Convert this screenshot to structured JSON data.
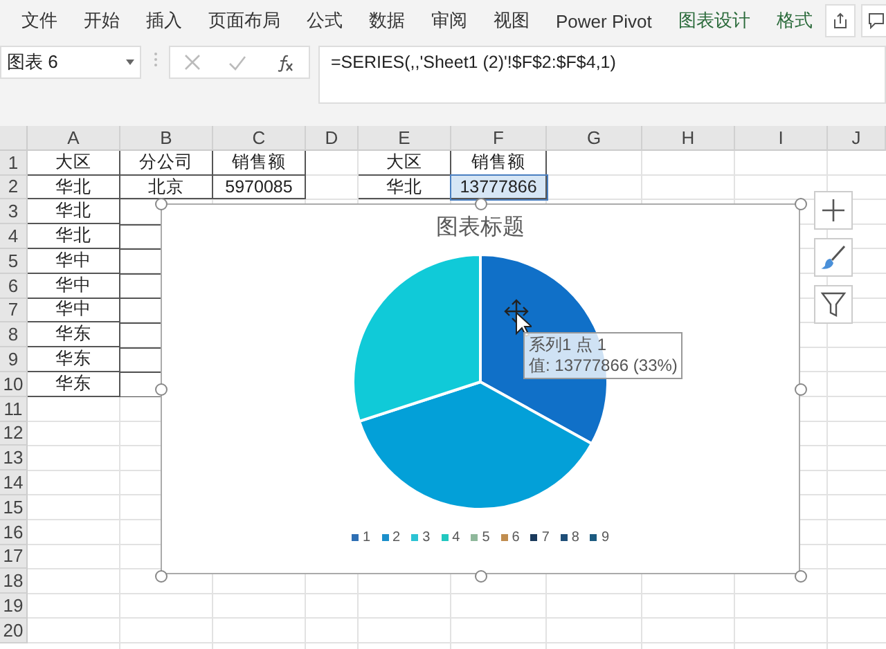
{
  "ribbon": {
    "tabs": [
      {
        "label": "文件",
        "selected": false
      },
      {
        "label": "开始",
        "selected": false
      },
      {
        "label": "插入",
        "selected": false
      },
      {
        "label": "页面布局",
        "selected": false
      },
      {
        "label": "公式",
        "selected": false
      },
      {
        "label": "数据",
        "selected": false
      },
      {
        "label": "审阅",
        "selected": false
      },
      {
        "label": "视图",
        "selected": false
      },
      {
        "label": "Power Pivot",
        "selected": false
      },
      {
        "label": "图表设计",
        "selected": false,
        "contextual": true
      },
      {
        "label": "格式",
        "selected": false,
        "contextual": true
      }
    ]
  },
  "formula_bar": {
    "name_box": "图表 6",
    "formula": "=SERIES(,,'Sheet1 (2)'!$F$2:$F$4,1)"
  },
  "sheet": {
    "columns": [
      "A",
      "B",
      "C",
      "D",
      "E",
      "F",
      "G",
      "H",
      "I",
      "J"
    ],
    "rows": [
      {
        "header": "1",
        "cells": [
          {
            "text": "大区",
            "selected": false
          },
          {
            "text": "分公司",
            "selected": false
          },
          {
            "text": "销售额",
            "selected": false
          },
          null,
          {
            "text": "大区",
            "selected": false
          },
          {
            "text": "销售额",
            "selected": false
          },
          null,
          null,
          null,
          null
        ]
      },
      {
        "header": "2",
        "cells": [
          {
            "text": "华北",
            "selected": false
          },
          {
            "text": "北京",
            "selected": false
          },
          {
            "text": "5970085",
            "selected": false
          },
          null,
          {
            "text": "华北",
            "selected": false
          },
          {
            "text": "13777866",
            "selected": true
          },
          null,
          null,
          null,
          null
        ]
      },
      {
        "header": "3",
        "cells": [
          {
            "text": "华北",
            "selected": false
          }
        ]
      },
      {
        "header": "4",
        "cells": [
          {
            "text": "华北",
            "selected": false
          }
        ]
      },
      {
        "header": "5",
        "cells": [
          {
            "text": "华中",
            "selected": false
          }
        ]
      },
      {
        "header": "6",
        "cells": [
          {
            "text": "华中",
            "selected": false
          }
        ]
      },
      {
        "header": "7",
        "cells": [
          {
            "text": "华中",
            "selected": false
          }
        ]
      },
      {
        "header": "8",
        "cells": [
          {
            "text": "华东",
            "selected": false
          }
        ]
      },
      {
        "header": "9",
        "cells": [
          {
            "text": "华东",
            "selected": false
          }
        ]
      },
      {
        "header": "10",
        "cells": [
          {
            "text": "华东",
            "selected": false
          }
        ]
      },
      {
        "header": "11",
        "cells": []
      },
      {
        "header": "12",
        "cells": []
      },
      {
        "header": "13",
        "cells": []
      },
      {
        "header": "14",
        "cells": []
      },
      {
        "header": "15",
        "cells": []
      },
      {
        "header": "16",
        "cells": []
      },
      {
        "header": "17",
        "cells": []
      },
      {
        "header": "18",
        "cells": []
      },
      {
        "header": "19",
        "cells": []
      },
      {
        "header": "20",
        "cells": []
      }
    ]
  },
  "chart": {
    "title": "图表标题",
    "legend": [
      {
        "label": "1",
        "color": "#2e6fb4"
      },
      {
        "label": "2",
        "color": "#1b8fcb"
      },
      {
        "label": "3",
        "color": "#2cc3d4"
      },
      {
        "label": "4",
        "color": "#22c8c0"
      },
      {
        "label": "5",
        "color": "#8fb89b"
      },
      {
        "label": "6",
        "color": "#c08d4f"
      },
      {
        "label": "7",
        "color": "#1a3a5c"
      },
      {
        "label": "8",
        "color": "#1f4e78"
      },
      {
        "label": "9",
        "color": "#1c5b80"
      }
    ],
    "tooltip": {
      "line_1": "系列1 点 1",
      "line_2": "值: 13777866 (33%)"
    }
  }
}
